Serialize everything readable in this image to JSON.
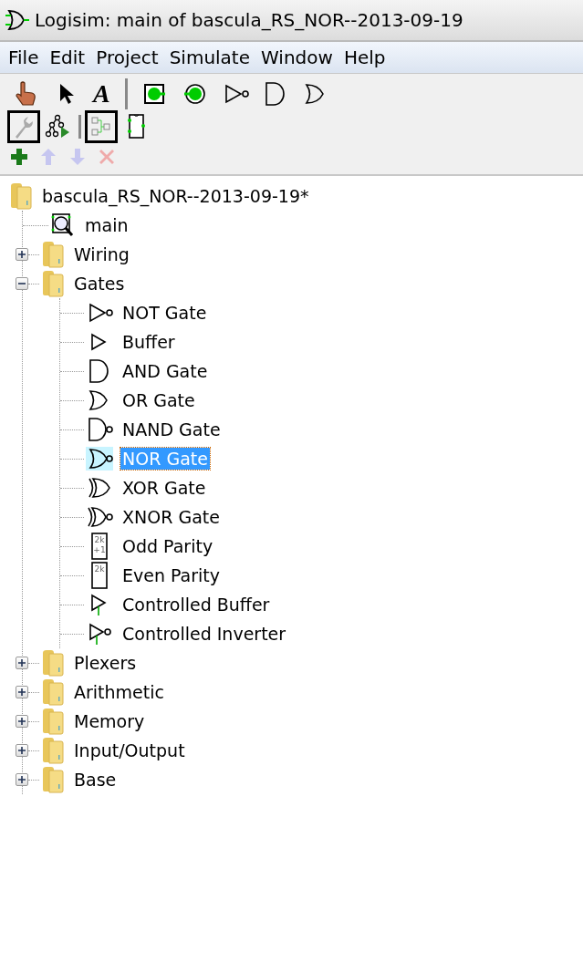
{
  "window": {
    "title": "Logisim: main of bascula_RS_NOR--2013-09-19"
  },
  "menu": [
    {
      "label": "File"
    },
    {
      "label": "Edit"
    },
    {
      "label": "Project"
    },
    {
      "label": "Simulate"
    },
    {
      "label": "Window"
    },
    {
      "label": "Help"
    }
  ],
  "toolbar": {
    "tools": [
      {
        "kind": "poke"
      },
      {
        "kind": "select"
      },
      {
        "kind": "text",
        "glyph": "A"
      }
    ],
    "components": [
      {
        "kind": "input-pin"
      },
      {
        "kind": "output-pin"
      },
      {
        "kind": "not"
      },
      {
        "kind": "and"
      },
      {
        "kind": "or"
      }
    ]
  },
  "view_toolbar": {
    "explorer": [
      {
        "kind": "wrench",
        "selected": true
      },
      {
        "kind": "simulation-tree",
        "selected": false
      }
    ],
    "editor": [
      {
        "kind": "layout",
        "selected": true
      },
      {
        "kind": "appearance",
        "selected": false
      }
    ]
  },
  "project_toolbar": [
    {
      "kind": "add",
      "disabled": false
    },
    {
      "kind": "up",
      "disabled": true
    },
    {
      "kind": "down",
      "disabled": true
    },
    {
      "kind": "delete",
      "disabled": true
    }
  ],
  "tree": {
    "label": "bascula_RS_NOR--2013-09-19*",
    "kind": "project",
    "selected": false,
    "children": [
      {
        "label": "main",
        "kind": "circuit",
        "selected": false
      },
      {
        "label": "Wiring",
        "kind": "folder",
        "expanded": false,
        "selected": false
      },
      {
        "label": "Gates",
        "kind": "folder",
        "expanded": true,
        "selected": false,
        "children": [
          {
            "label": "NOT Gate",
            "kind": "not",
            "selected": false
          },
          {
            "label": "Buffer",
            "kind": "buffer",
            "selected": false
          },
          {
            "label": "AND Gate",
            "kind": "and",
            "selected": false
          },
          {
            "label": "OR Gate",
            "kind": "or",
            "selected": false
          },
          {
            "label": "NAND Gate",
            "kind": "nand",
            "selected": false
          },
          {
            "label": "NOR Gate",
            "kind": "nor",
            "selected": true
          },
          {
            "label": "XOR Gate",
            "kind": "xor",
            "selected": false
          },
          {
            "label": "XNOR Gate",
            "kind": "xnor",
            "selected": false
          },
          {
            "label": "Odd Parity",
            "kind": "parity",
            "icon_lines": [
              "2k",
              "+1"
            ],
            "selected": false
          },
          {
            "label": "Even Parity",
            "kind": "parity",
            "icon_lines": [
              "2k"
            ],
            "selected": false
          },
          {
            "label": "Controlled Buffer",
            "kind": "controlled-buffer",
            "selected": false
          },
          {
            "label": "Controlled Inverter",
            "kind": "controlled-inverter",
            "selected": false
          }
        ]
      },
      {
        "label": "Plexers",
        "kind": "folder",
        "expanded": false,
        "selected": false
      },
      {
        "label": "Arithmetic",
        "kind": "folder",
        "expanded": false,
        "selected": false
      },
      {
        "label": "Memory",
        "kind": "folder",
        "expanded": false,
        "selected": false
      },
      {
        "label": "Input/Output",
        "kind": "folder",
        "expanded": false,
        "selected": false
      },
      {
        "label": "Base",
        "kind": "folder",
        "expanded": false,
        "selected": false
      }
    ]
  }
}
